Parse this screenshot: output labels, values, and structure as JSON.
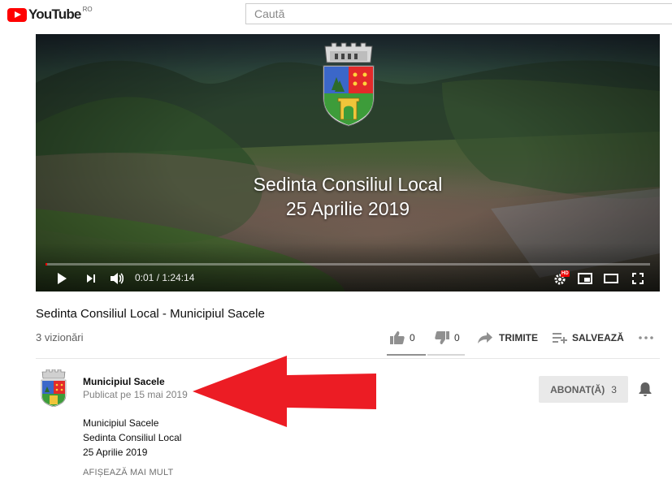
{
  "header": {
    "logo_text": "YouTube",
    "logo_country": "RO",
    "search_placeholder": "Caută"
  },
  "player": {
    "overlay_line1": "Sedinta Consiliul Local",
    "overlay_line2": "25 Aprilie 2019",
    "time": "0:01 / 1:24:14",
    "progress": 0.0002,
    "quality_badge": "HD"
  },
  "video": {
    "title": "Sedinta Consiliul Local - Municipiul Sacele",
    "views": "3 vizionări",
    "likes": "0",
    "dislikes": "0",
    "share_label": "TRIMITE",
    "save_label": "SALVEAZĂ"
  },
  "channel": {
    "name": "Municipiul Sacele",
    "published": "Publicat pe 15 mai 2019",
    "subscribe_label": "ABONAT(Ă)",
    "subscriber_count": "3"
  },
  "description": {
    "lines": [
      "Municipiul Sacele",
      "Sedinta Consiliul Local",
      "25 Aprilie 2019"
    ],
    "show_more": "AFIȘEAZĂ MAI MULT"
  },
  "colors": {
    "brand_red": "#ff0000",
    "arrow_red": "#ec1c24"
  }
}
